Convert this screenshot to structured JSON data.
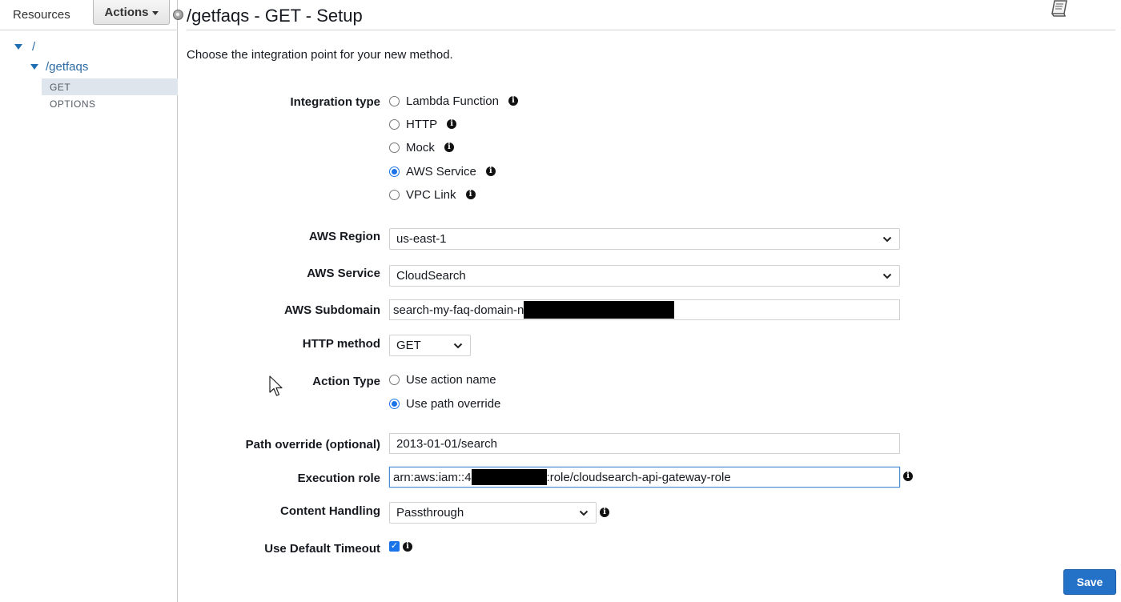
{
  "sidebar": {
    "title": "Resources",
    "actions_label": "Actions",
    "tree": {
      "root": "/",
      "resource": "/getfaqs",
      "methods": [
        "GET",
        "OPTIONS"
      ]
    }
  },
  "page": {
    "title": "/getfaqs - GET - Setup",
    "intro": "Choose the integration point for your new method."
  },
  "form": {
    "integration_type": {
      "label": "Integration type",
      "options": [
        "Lambda Function",
        "HTTP",
        "Mock",
        "AWS Service",
        "VPC Link"
      ],
      "selected": "AWS Service"
    },
    "aws_region": {
      "label": "AWS Region",
      "value": "us-east-1"
    },
    "aws_service": {
      "label": "AWS Service",
      "value": "CloudSearch"
    },
    "aws_subdomain": {
      "label": "AWS Subdomain",
      "value_visible": "search-my-faq-domain-n"
    },
    "http_method": {
      "label": "HTTP method",
      "value": "GET"
    },
    "action_type": {
      "label": "Action Type",
      "options": [
        "Use action name",
        "Use path override"
      ],
      "selected": "Use path override"
    },
    "path_override": {
      "label": "Path override (optional)",
      "value": "2013-01-01/search"
    },
    "execution_role": {
      "label": "Execution role",
      "prefix": "arn:aws:iam::4",
      "suffix": ":role/cloudsearch-api-gateway-role"
    },
    "content_handling": {
      "label": "Content Handling",
      "value": "Passthrough"
    },
    "default_timeout": {
      "label": "Use Default Timeout",
      "checked": true
    }
  },
  "buttons": {
    "save": "Save"
  },
  "colors": {
    "accent": "#1a73e8",
    "save_button": "#2472c8",
    "link": "#2d6aa3"
  },
  "icons": [
    "book-icon",
    "info-icon",
    "chevron-down-icon",
    "caret-down-icon",
    "triangle-expand-icon",
    "mouse-pointer-icon"
  ]
}
